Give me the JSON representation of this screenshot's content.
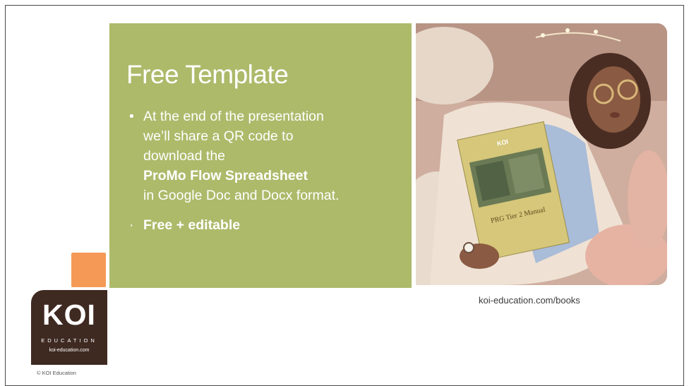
{
  "slide": {
    "title": "Free Template",
    "bullets": [
      {
        "marker": "•",
        "line1": "At the end of the presentation",
        "line2": "we’ll share a QR code to",
        "line3": "download the",
        "highlight": "ProMo Flow Spreadsheet",
        "line4": "in Google Doc and Docx format."
      },
      {
        "marker": "·",
        "text": "Free + editable"
      }
    ],
    "photo_caption": "koi-education.com/books",
    "book_title": "PRG Tier 2 Manual",
    "book_brand": "KOI"
  },
  "logo": {
    "name": "KOI",
    "subtitle": "EDUCATION",
    "url": "koi-education.com"
  },
  "footer": {
    "copyright": "© KOI Education"
  },
  "colors": {
    "green_panel": "#adba6a",
    "orange_square": "#f49a56",
    "logo_background": "#3f2a22",
    "text_on_panel": "#ffffff"
  }
}
